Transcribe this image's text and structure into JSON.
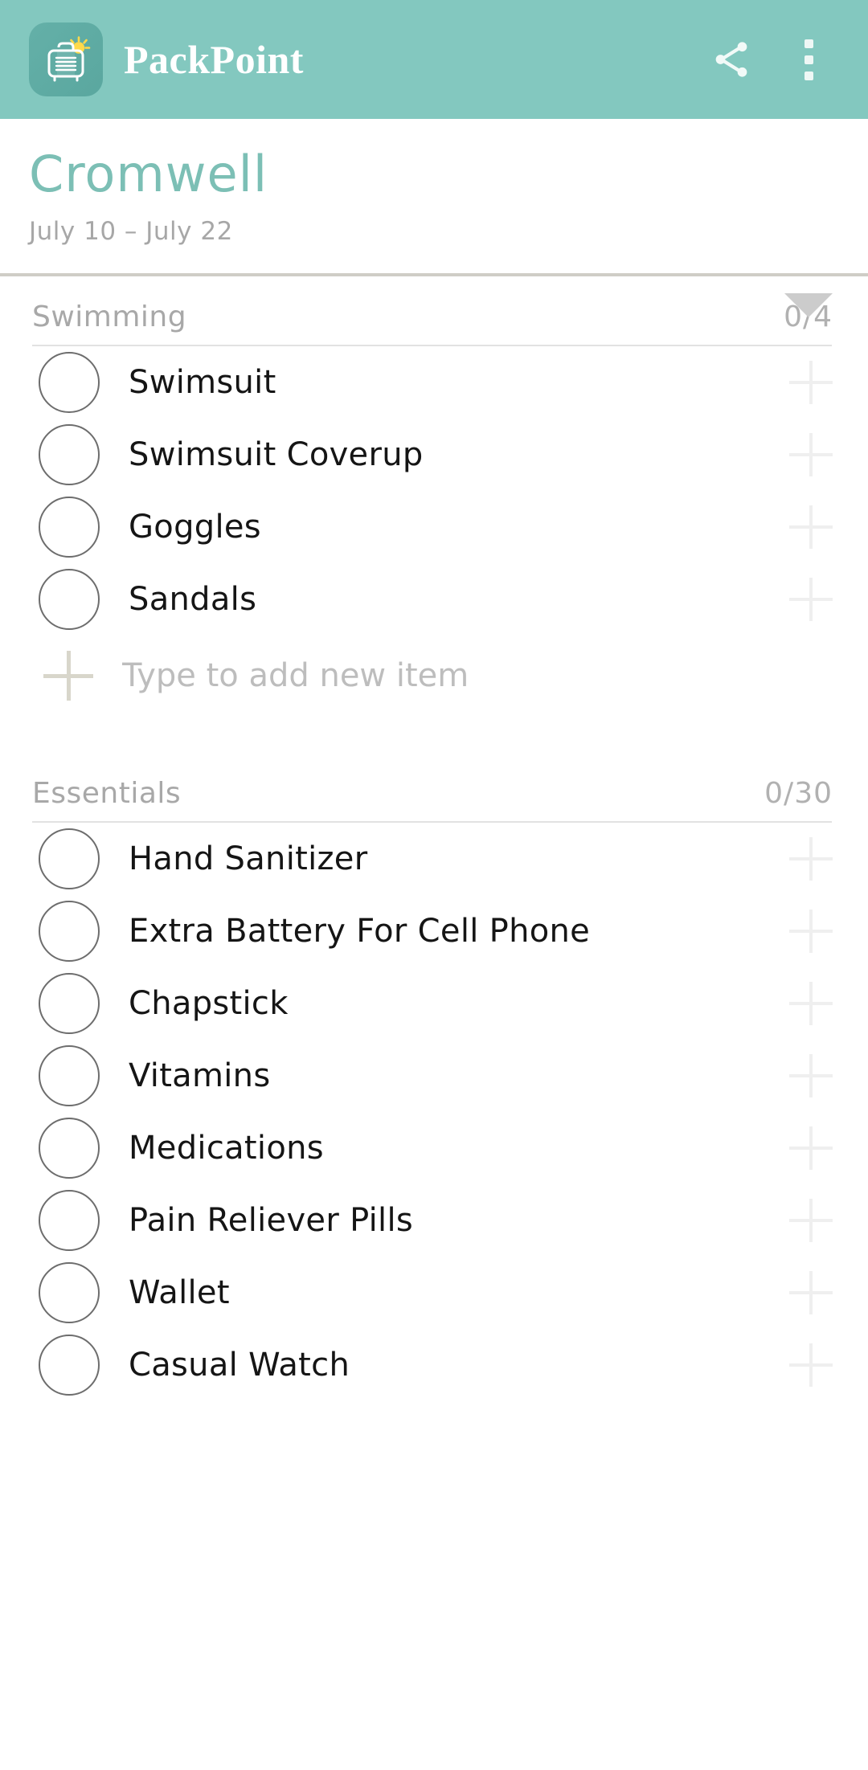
{
  "appbar": {
    "app_name": "PackPoint",
    "logo_icon": "suitcase-sun-icon",
    "share_icon": "share-icon",
    "overflow_icon": "more-vertical-icon",
    "background_color": "#83c8bf",
    "text_color": "#ffffff"
  },
  "trip": {
    "name": "Cromwell",
    "dates": "July 10 – July 22",
    "caret_icon": "chevron-down-icon",
    "accent_color": "#7cbfb5"
  },
  "sections": [
    {
      "title": "Swimming",
      "count": "0/4",
      "checked": 0,
      "total": 4,
      "items": [
        {
          "label": "Swimsuit",
          "checked": false
        },
        {
          "label": "Swimsuit Coverup",
          "checked": false
        },
        {
          "label": "Goggles",
          "checked": false
        },
        {
          "label": "Sandals",
          "checked": false
        }
      ],
      "add_row": {
        "placeholder": "Type to add new item",
        "value": "",
        "icon": "plus-icon"
      }
    },
    {
      "title": "Essentials",
      "count": "0/30",
      "checked": 0,
      "total": 30,
      "items": [
        {
          "label": "Hand Sanitizer",
          "checked": false
        },
        {
          "label": "Extra Battery For Cell Phone",
          "checked": false
        },
        {
          "label": "Chapstick",
          "checked": false
        },
        {
          "label": "Vitamins",
          "checked": false
        },
        {
          "label": "Medications",
          "checked": false
        },
        {
          "label": "Pain Reliever Pills",
          "checked": false
        },
        {
          "label": "Wallet",
          "checked": false
        },
        {
          "label": "Casual Watch",
          "checked": false
        }
      ]
    }
  ],
  "row_plus_icon": "plus-icon",
  "colors": {
    "teal": "#83c8bf",
    "teal_text": "#7cbfb5",
    "muted_text": "#a8a8a8",
    "item_text": "#151515",
    "plus_grey": "#efefef"
  }
}
